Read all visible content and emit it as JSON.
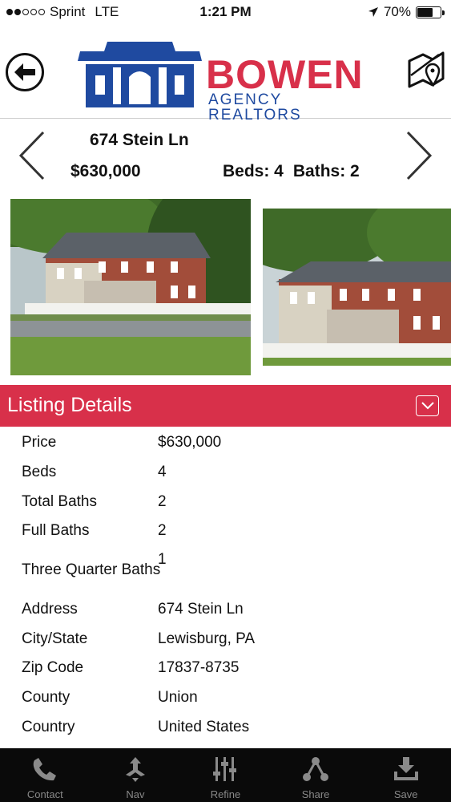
{
  "status_bar": {
    "carrier": "Sprint",
    "network": "LTE",
    "time": "1:21 PM",
    "battery_percent": "70%",
    "battery_level": 0.7,
    "signal_bars": 2
  },
  "header": {
    "logo_name": "BOWEN",
    "logo_sub": "AGENCY REALTORS",
    "brand_red": "#d8304a",
    "brand_blue": "#1f4aa0"
  },
  "listing": {
    "address": "674 Stein Ln",
    "price": "$630,000",
    "beds": "Beds: 4",
    "baths": "Baths: 2"
  },
  "section": {
    "title": "Listing Details"
  },
  "details": [
    {
      "label": "Price",
      "value": "$630,000"
    },
    {
      "label": "Beds",
      "value": "4"
    },
    {
      "label": "Total Baths",
      "value": "2"
    },
    {
      "label": "Full Baths",
      "value": "2"
    },
    {
      "label": "Three Quarter Baths",
      "value": "1"
    },
    {
      "label": "Address",
      "value": "674 Stein Ln"
    },
    {
      "label": "City/State",
      "value": "Lewisburg, PA"
    },
    {
      "label": "Zip Code",
      "value": "17837-8735"
    },
    {
      "label": "County",
      "value": "Union"
    },
    {
      "label": "Country",
      "value": "United States"
    }
  ],
  "bottom_nav": [
    {
      "label": "Contact",
      "icon": "phone-icon"
    },
    {
      "label": "Nav",
      "icon": "arrows-icon"
    },
    {
      "label": "Refine",
      "icon": "sliders-icon"
    },
    {
      "label": "Share",
      "icon": "share-icon"
    },
    {
      "label": "Save",
      "icon": "download-icon"
    }
  ]
}
